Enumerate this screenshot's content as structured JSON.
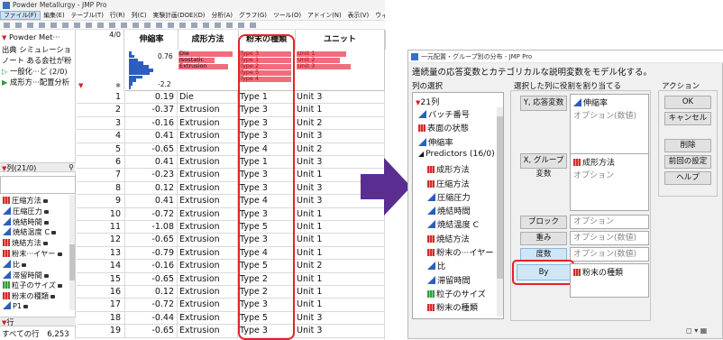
{
  "left_window": {
    "title": "Powder Metallurgy - JMP Pro",
    "menu": [
      "ファイル(F)",
      "編集(E)",
      "テーブル(T)",
      "行(R)",
      "列(C)",
      "実験計画(DOE)(D)",
      "分析(A)",
      "グラフ(G)",
      "ツール(O)",
      "アドイン(N)",
      "表示(V)",
      "ウィンドウ(W)",
      "ヘルプ(H)"
    ],
    "table_panel": {
      "table_name": "Powder Met···",
      "source_label": "出典 シミュレーショ",
      "note_label": "ノート ある会社が粉",
      "script1": "一般化···ど (2/0)",
      "script2": "成形方···配置分析"
    },
    "columns_panel": {
      "header": "列(21/0)",
      "items": [
        {
          "label": "圧縮方法",
          "icon": "nominal"
        },
        {
          "label": "圧縮圧力",
          "icon": "continuous"
        },
        {
          "label": "焼結時間",
          "icon": "continuous"
        },
        {
          "label": "焼結温度 C",
          "icon": "continuous"
        },
        {
          "label": "焼結方法",
          "icon": "nominal"
        },
        {
          "label": "粉末···イヤー",
          "icon": "nominal"
        },
        {
          "label": "比",
          "icon": "continuous"
        },
        {
          "label": "滞留時間",
          "icon": "continuous"
        },
        {
          "label": "粒子のサイズ",
          "icon": "ordinal"
        },
        {
          "label": "粉末の種類",
          "icon": "nominal"
        },
        {
          "label": "P1",
          "icon": "continuous"
        }
      ]
    },
    "rows_panel": {
      "header": "行",
      "all_rows_label": "すべての行",
      "all_rows_value": "6,253"
    },
    "grid": {
      "row_count_label": "4/0",
      "columns": [
        "伸縮率",
        "成形方法",
        "粉末の種類",
        "ユニット"
      ],
      "hist_max_label": "0.76",
      "hist_min_label": "-2.2",
      "method_labels": [
        "Die",
        "Isostatic",
        "Extrusion"
      ],
      "type_labels": [
        "Type 3",
        "Type 1",
        "Type 2",
        "Type 5",
        "Type 4"
      ],
      "unit_labels": [
        "Unit 1",
        "Unit 2",
        "Unit 3"
      ],
      "rows": [
        [
          "1",
          "0.19",
          "Die",
          "Type 1",
          "Unit 3"
        ],
        [
          "2",
          "-0.37",
          "Extrusion",
          "Type 3",
          "Unit 1"
        ],
        [
          "3",
          "-0.16",
          "Extrusion",
          "Type 3",
          "Unit 2"
        ],
        [
          "4",
          "0.41",
          "Extrusion",
          "Type 3",
          "Unit 3"
        ],
        [
          "5",
          "-0.65",
          "Extrusion",
          "Type 4",
          "Unit 2"
        ],
        [
          "6",
          "0.41",
          "Extrusion",
          "Type 1",
          "Unit 3"
        ],
        [
          "7",
          "-0.23",
          "Extrusion",
          "Type 3",
          "Unit 1"
        ],
        [
          "8",
          "0.12",
          "Extrusion",
          "Type 3",
          "Unit 3"
        ],
        [
          "9",
          "0.41",
          "Extrusion",
          "Type 4",
          "Unit 3"
        ],
        [
          "10",
          "-0.72",
          "Extrusion",
          "Type 3",
          "Unit 1"
        ],
        [
          "11",
          "-1.08",
          "Extrusion",
          "Type 5",
          "Unit 1"
        ],
        [
          "12",
          "-0.65",
          "Extrusion",
          "Type 3",
          "Unit 1"
        ],
        [
          "13",
          "-0.79",
          "Extrusion",
          "Type 4",
          "Unit 1"
        ],
        [
          "14",
          "-0.16",
          "Extrusion",
          "Type 5",
          "Unit 2"
        ],
        [
          "15",
          "-0.65",
          "Extrusion",
          "Type 2",
          "Unit 1"
        ],
        [
          "16",
          "0.12",
          "Extrusion",
          "Type 2",
          "Unit 1"
        ],
        [
          "17",
          "-0.72",
          "Extrusion",
          "Type 3",
          "Unit 1"
        ],
        [
          "18",
          "-0.44",
          "Extrusion",
          "Type 5",
          "Unit 3"
        ],
        [
          "19",
          "-0.65",
          "Extrusion",
          "Type 3",
          "Unit 3"
        ]
      ]
    }
  },
  "dialog": {
    "title": "一元配置・グループ別の分布 - JMP Pro",
    "description": "連続量の応答変数とカテゴリカルな説明変数をモデル化する。",
    "select_columns_label": "列の選択",
    "column_count": "21列",
    "columns": [
      {
        "label": "バッチ番号",
        "icon": "continuous",
        "indent": 0
      },
      {
        "label": "表面の状態",
        "icon": "nominal",
        "indent": 0
      },
      {
        "label": "伸縮率",
        "icon": "continuous",
        "indent": 0
      },
      {
        "label": "Predictors (16/0)",
        "icon": "group",
        "indent": 0
      },
      {
        "label": "成形方法",
        "icon": "nominal",
        "indent": 1
      },
      {
        "label": "圧縮方法",
        "icon": "nominal",
        "indent": 1
      },
      {
        "label": "圧縮圧力",
        "icon": "continuous",
        "indent": 1
      },
      {
        "label": "焼結時間",
        "icon": "continuous",
        "indent": 1
      },
      {
        "label": "焼結温度 C",
        "icon": "continuous",
        "indent": 1
      },
      {
        "label": "焼結方法",
        "icon": "nominal",
        "indent": 1
      },
      {
        "label": "粉末の···イヤー",
        "icon": "nominal",
        "indent": 1
      },
      {
        "label": "比",
        "icon": "continuous",
        "indent": 1
      },
      {
        "label": "滞留時間",
        "icon": "continuous",
        "indent": 1
      },
      {
        "label": "粒子のサイズ",
        "icon": "ordinal",
        "indent": 1
      },
      {
        "label": "粉末の種類",
        "icon": "nominal",
        "indent": 1
      }
    ],
    "roles_label": "選択した列に役割を割り当てる",
    "y_button": "Y, 応答変数",
    "y_value": "伸縮率",
    "y_hint": "オプション(数値)",
    "x_button": "X, グループ変数",
    "x_value": "成形方法",
    "x_hint": "オプション",
    "block_button": "ブロック",
    "block_hint": "オプション",
    "weight_button": "重み",
    "weight_hint": "オプション(数値)",
    "freq_button": "度数",
    "freq_hint": "オプション(数値)",
    "by_button": "By",
    "by_value": "粉末の種類",
    "action_label": "アクション",
    "ok": "OK",
    "cancel": "キャンセル",
    "remove": "削除",
    "recall": "前回の設定",
    "help": "ヘルプ"
  },
  "colors": {
    "highlight": "#e4222b",
    "histbar": "#2c5fbd",
    "selected": "#f06d7d",
    "accent_arrow": "#5a2d91"
  }
}
